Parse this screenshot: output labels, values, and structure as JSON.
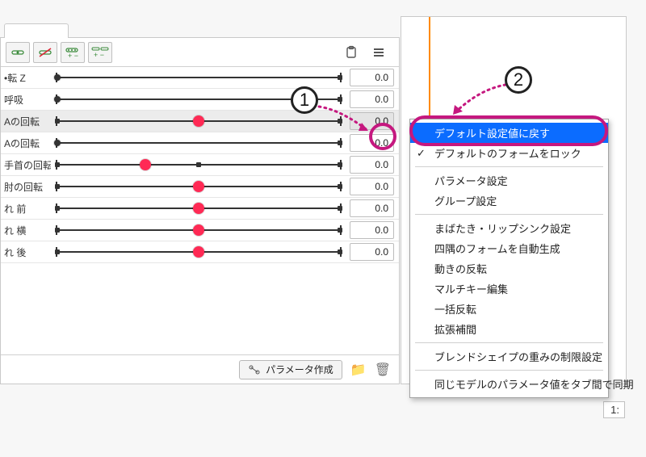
{
  "annotations": {
    "n1": "1",
    "n2": "2"
  },
  "params": [
    {
      "label": "•転 Z",
      "value": "0.0",
      "layout": "2pt",
      "pink": false,
      "handle_left": true
    },
    {
      "label": "呼吸",
      "value": "0.0",
      "layout": "2pt",
      "pink": false,
      "handle_left": true
    },
    {
      "label": "Aの回転",
      "value": "0.0",
      "layout": "3pt",
      "pink": true,
      "selected": true
    },
    {
      "label": "Aの回転",
      "value": "0.0",
      "layout": "2pt",
      "pink": false,
      "handle_left": true
    },
    {
      "label": "手首の回転",
      "value": "0.0",
      "layout": "3ptL",
      "pink": true
    },
    {
      "label": "肘の回転",
      "value": "0.0",
      "layout": "3pt",
      "pink": true
    },
    {
      "label": "れ 前",
      "value": "0.0",
      "layout": "3pt",
      "pink": true
    },
    {
      "label": "れ 横",
      "value": "0.0",
      "layout": "3pt",
      "pink": true
    },
    {
      "label": "れ 後",
      "value": "0.0",
      "layout": "3pt",
      "pink": true
    }
  ],
  "bottom": {
    "create_label": "パラメータ作成"
  },
  "menu": {
    "items": [
      {
        "label": "デフォルト設定値に戻す",
        "highlight": true
      },
      {
        "label": "デフォルトのフォームをロック",
        "checked": true
      },
      "sep",
      {
        "label": "パラメータ設定"
      },
      {
        "label": "グループ設定"
      },
      "sep",
      {
        "label": "まばたき・リップシンク設定"
      },
      {
        "label": "四隅のフォームを自動生成"
      },
      {
        "label": "動きの反転"
      },
      {
        "label": "マルチキー編集"
      },
      {
        "label": "一括反転"
      },
      {
        "label": "拡張補間"
      },
      "sep",
      {
        "label": "ブレンドシェイプの重みの制限設定"
      },
      "sep",
      {
        "label": "同じモデルのパラメータ値をタブ間で同期"
      }
    ]
  },
  "zoom": "1:"
}
